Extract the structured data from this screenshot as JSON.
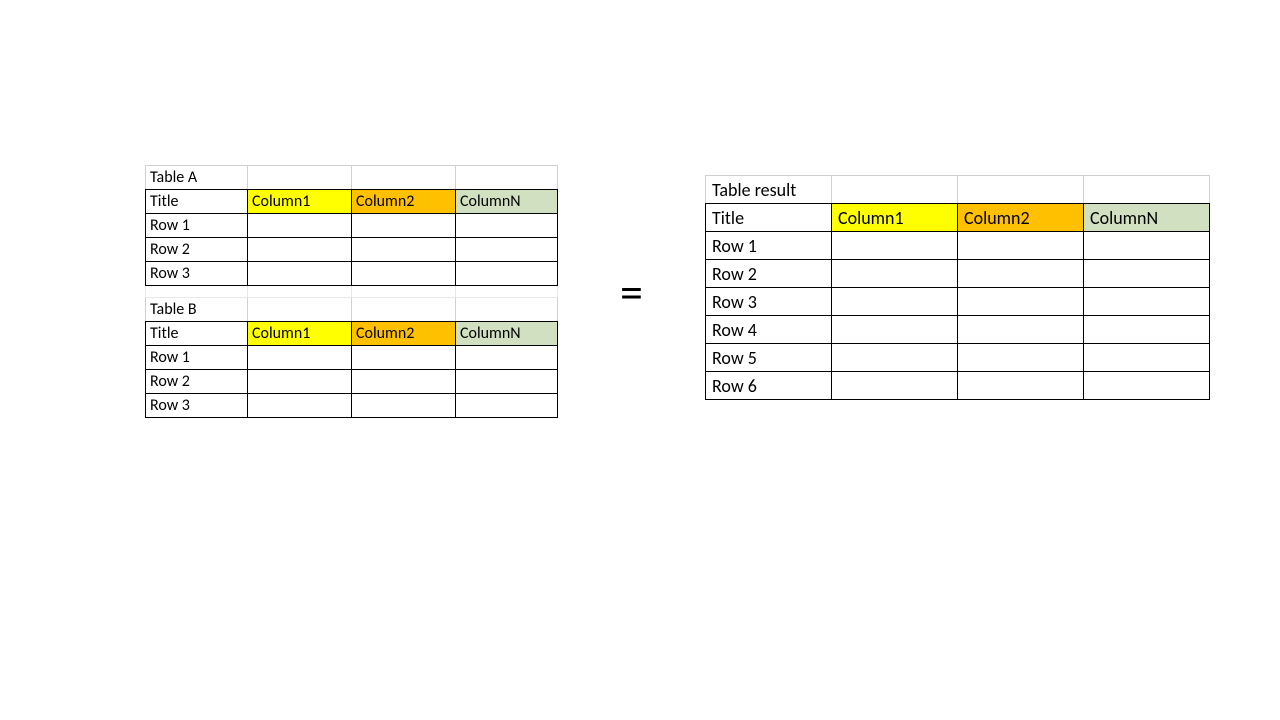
{
  "left": {
    "tableA": {
      "name": "Table A",
      "header": {
        "title": "Title",
        "col1": "Column1",
        "col2": "Column2",
        "colN": "ColumnN"
      },
      "rows": [
        "Row 1",
        "Row 2",
        "Row 3"
      ]
    },
    "tableB": {
      "name": "Table B",
      "header": {
        "title": "Title",
        "col1": "Column1",
        "col2": "Column2",
        "colN": "ColumnN"
      },
      "rows": [
        "Row 1",
        "Row 2",
        "Row 3"
      ]
    }
  },
  "equals": "=",
  "result": {
    "name": "Table result",
    "header": {
      "title": "Title",
      "col1": "Column1",
      "col2": "Column2",
      "colN": "ColumnN"
    },
    "rows": [
      "Row 1",
      "Row 2",
      "Row 3",
      "Row 4",
      "Row 5",
      "Row 6"
    ]
  },
  "colors": {
    "col1": "#ffff00",
    "col2": "#ffc000",
    "colN": "#d0e0c0"
  }
}
